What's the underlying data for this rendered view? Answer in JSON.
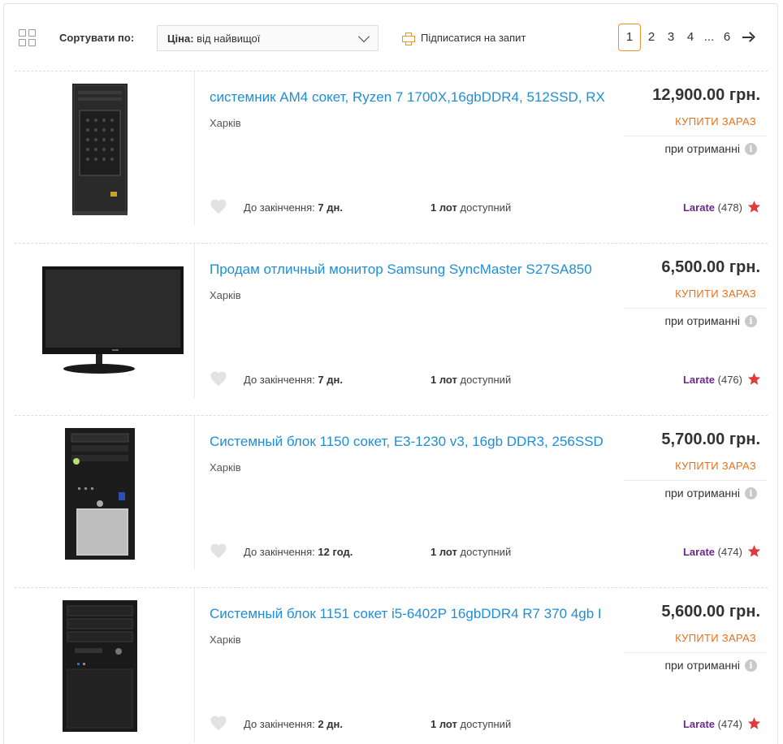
{
  "toolbar": {
    "sort_label": "Сортувати по:",
    "sort_prefix": "Ціна:",
    "sort_value": "від найвищої",
    "subscribe_label": "Підписатися на запит",
    "pages": [
      "1",
      "2",
      "3",
      "4",
      "...",
      "6"
    ],
    "active_page": "1"
  },
  "listings": [
    {
      "title": "системник AM4 сокет, Ryzen 7 1700X,16gbDDR4, 512SSD, RX",
      "city": "Харків",
      "price": "12,900.00 грн.",
      "buy_label": "Купити зараз",
      "payment": "при отриманні",
      "deadline_label": "До закінчення:",
      "deadline_value": "7 дн.",
      "lots_count": "1 лот",
      "lots_label": "доступний",
      "seller_name": "Larate",
      "seller_rating": "(478)",
      "image": "pc-tower-icon"
    },
    {
      "title": "Продам отличный монитор Samsung SyncMaster S27SA850",
      "city": "Харків",
      "price": "6,500.00 грн.",
      "buy_label": "Купити зараз",
      "payment": "при отриманні",
      "deadline_label": "До закінчення:",
      "deadline_value": "7 дн.",
      "lots_count": "1 лот",
      "lots_label": "доступний",
      "seller_name": "Larate",
      "seller_rating": "(476)",
      "image": "monitor-icon"
    },
    {
      "title": "Системный блок 1150 сокет, E3-1230 v3, 16gb DDR3, 256SSD",
      "city": "Харків",
      "price": "5,700.00 грн.",
      "buy_label": "Купити зараз",
      "payment": "при отриманні",
      "deadline_label": "До закінчення:",
      "deadline_value": "12 год.",
      "lots_count": "1 лот",
      "lots_label": "доступний",
      "seller_name": "Larate",
      "seller_rating": "(474)",
      "image": "pc-tower-icon"
    },
    {
      "title": "Системный блок 1151 сокет i5-6402P 16gbDDR4 R7 370 4gb I",
      "city": "Харків",
      "price": "5,600.00 грн.",
      "buy_label": "Купити зараз",
      "payment": "при отриманні",
      "deadline_label": "До закінчення:",
      "deadline_value": "2 дн.",
      "lots_count": "1 лот",
      "lots_label": "доступний",
      "seller_name": "Larate",
      "seller_rating": "(474)",
      "image": "pc-tower-icon"
    }
  ],
  "colors": {
    "link": "#1f8ed6",
    "accent": "#e8962a",
    "buy": "#e8701a",
    "seller": "#6a2b84",
    "star": "#e03a3a"
  }
}
